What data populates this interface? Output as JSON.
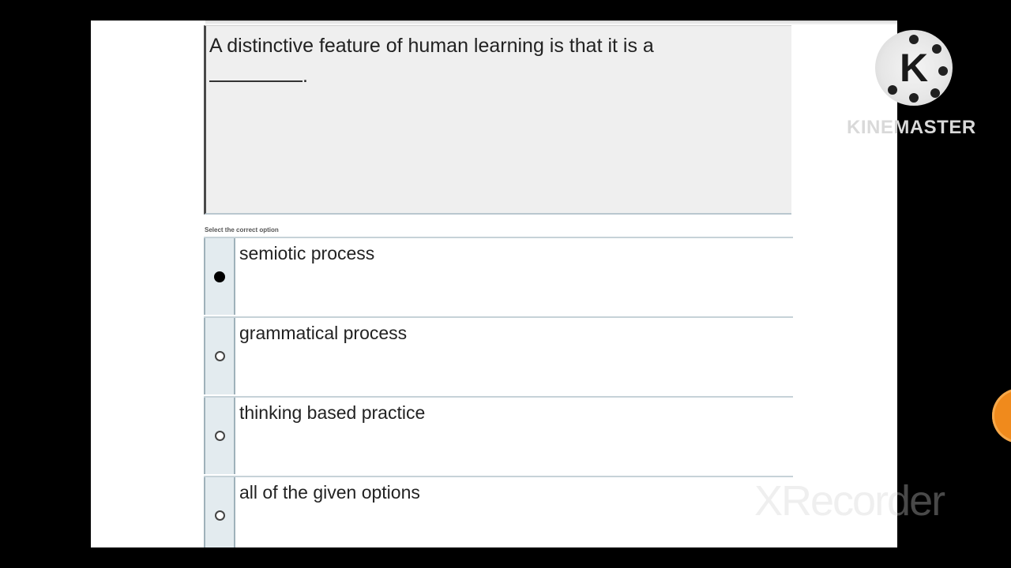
{
  "question": {
    "text": "A distinctive feature of human learning is that it is a",
    "blank_suffix": "."
  },
  "options_caption": "Select the correct option",
  "options": [
    {
      "label": "semiotic process",
      "selected": true
    },
    {
      "label": "grammatical process",
      "selected": false
    },
    {
      "label": "thinking based practice",
      "selected": false
    },
    {
      "label": "all of the given options",
      "selected": false
    }
  ],
  "watermarks": {
    "kinemaster_letter": "K",
    "kinemaster_text": "KINEMASTER",
    "xrecorder_text": "XRecorder"
  },
  "colors": {
    "radio_cell": "#e3ebef",
    "row_border": "#c6d2d8",
    "question_bg": "#efefef",
    "orange_badge": "#f08a1c"
  }
}
